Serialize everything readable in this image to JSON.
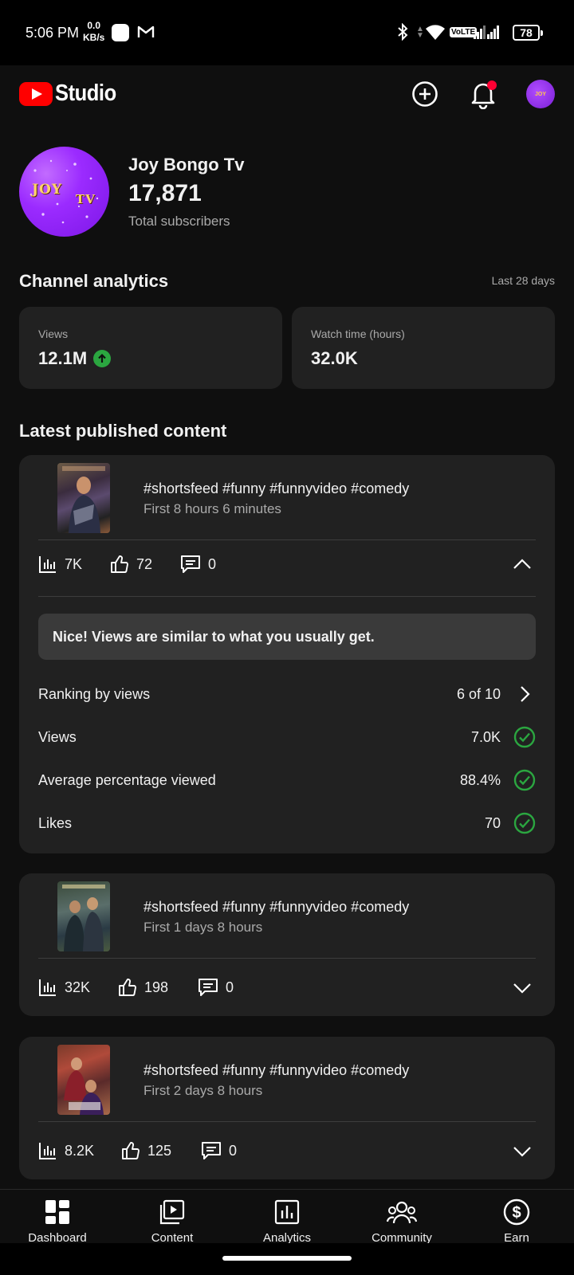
{
  "status_bar": {
    "time": "5:06 PM",
    "speed_value": "0.0",
    "speed_unit": "KB/s",
    "network": "VoLTE",
    "battery": "78"
  },
  "header": {
    "logo_text": "Studio",
    "icons": [
      "create-icon",
      "notifications-icon",
      "account-avatar"
    ],
    "accent": "#ff0000",
    "notification_dot_color": "#ff0033"
  },
  "channel": {
    "name": "Joy Bongo Tv",
    "subscribers": "17,871",
    "subscribers_label": "Total subscribers",
    "avatar_text": "JOY",
    "avatar_text_2": "TV"
  },
  "analytics": {
    "title": "Channel analytics",
    "period": "Last 28 days",
    "cards": [
      {
        "label": "Views",
        "value": "12.1M",
        "trend": "up"
      },
      {
        "label": "Watch time (hours)",
        "value": "32.0K"
      }
    ]
  },
  "latest": {
    "title": "Latest published content",
    "items": [
      {
        "title": "#shortsfeed #funny #funnyvideo #comedy",
        "subtitle": "First 8 hours 6 minutes",
        "views": "7K",
        "likes": "72",
        "comments": "0",
        "expanded": true,
        "callout": "Nice! Views are similar to what you usually get.",
        "rows": [
          {
            "label": "Ranking by views",
            "value": "6 of 10",
            "icon": "chevron-right-icon"
          },
          {
            "label": "Views",
            "value": "7.0K",
            "icon": "check-circle-icon"
          },
          {
            "label": "Average percentage viewed",
            "value": "88.4%",
            "icon": "check-circle-icon"
          },
          {
            "label": "Likes",
            "value": "70",
            "icon": "check-circle-icon"
          }
        ]
      },
      {
        "title": "#shortsfeed #funny #funnyvideo #comedy",
        "subtitle": "First 1 days 8 hours",
        "views": "32K",
        "likes": "198",
        "comments": "0",
        "expanded": false
      },
      {
        "title": "#shortsfeed #funny #funnyvideo #comedy",
        "subtitle": "First 2 days 8 hours",
        "views": "8.2K",
        "likes": "125",
        "comments": "0",
        "expanded": false
      }
    ]
  },
  "bottom_nav": [
    {
      "label": "Dashboard",
      "icon": "dashboard-icon",
      "active": true
    },
    {
      "label": "Content",
      "icon": "content-icon"
    },
    {
      "label": "Analytics",
      "icon": "analytics-icon"
    },
    {
      "label": "Community",
      "icon": "community-icon"
    },
    {
      "label": "Earn",
      "icon": "earn-icon"
    }
  ],
  "colors": {
    "background": "#0f0f0f",
    "card": "#212121",
    "success": "#2ba640",
    "muted_text": "#aaaaaa"
  }
}
